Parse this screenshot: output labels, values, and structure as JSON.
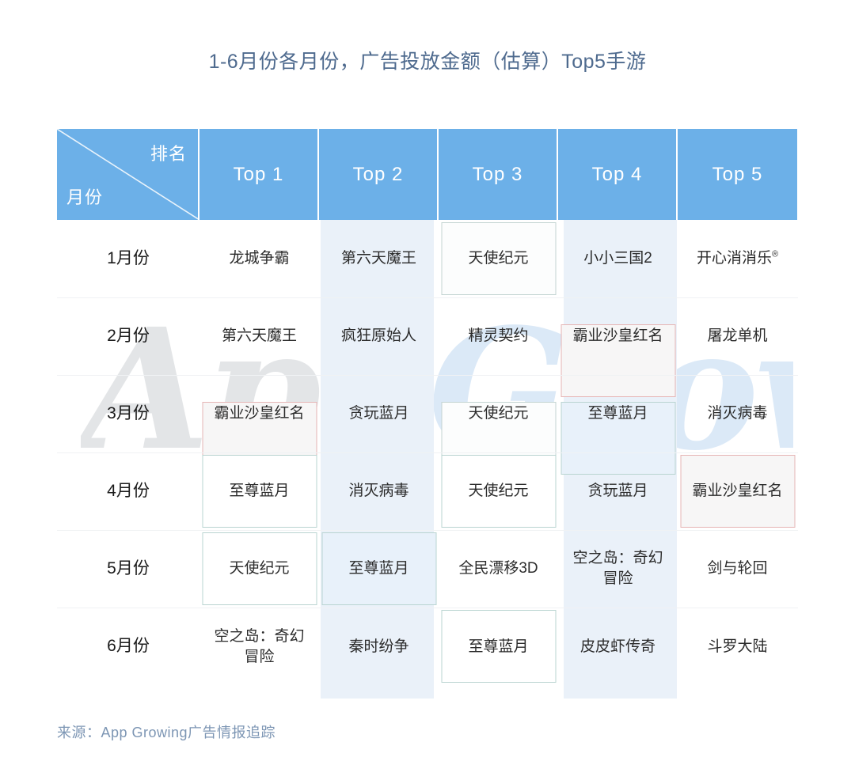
{
  "title": "1-6月份各月份，广告投放金额（估算）Top5手游",
  "source": "来源：App Growing广告情报追踪",
  "watermark": {
    "part1": "App",
    "part2": "Growing"
  },
  "header": {
    "corner_rank": "排名",
    "corner_month": "月份",
    "columns": [
      "Top 1",
      "Top 2",
      "Top 3",
      "Top 4",
      "Top 5"
    ]
  },
  "colors": {
    "header_bg": "#6cb0e8",
    "title_text": "#4e6a8e",
    "source_text": "#7d96b4",
    "column_tint": "#eaf1f9",
    "highlight_teal_border": "#b9d4d1",
    "highlight_pink_border": "#e6b4b4",
    "highlight_teal_fill": "#e8f1fa"
  },
  "rows": [
    {
      "month": "1月份",
      "cells": [
        {
          "text": "龙城争霸"
        },
        {
          "text": "第六天魔王"
        },
        {
          "text": "天使纪元"
        },
        {
          "text": "小小三国2"
        },
        {
          "text": "开心消消乐",
          "sup": "®"
        }
      ]
    },
    {
      "month": "2月份",
      "cells": [
        {
          "text": "第六天魔王"
        },
        {
          "text": "疯狂原始人"
        },
        {
          "text": "精灵契约"
        },
        {
          "text": "霸业沙皇红名"
        },
        {
          "text": "屠龙单机"
        }
      ]
    },
    {
      "month": "3月份",
      "cells": [
        {
          "text": "霸业沙皇红名"
        },
        {
          "text": "贪玩蓝月"
        },
        {
          "text": "天使纪元"
        },
        {
          "text": "至尊蓝月"
        },
        {
          "text": "消灭病毒"
        }
      ]
    },
    {
      "month": "4月份",
      "cells": [
        {
          "text": "至尊蓝月"
        },
        {
          "text": "消灭病毒"
        },
        {
          "text": "天使纪元"
        },
        {
          "text": "贪玩蓝月"
        },
        {
          "text": "霸业沙皇红名"
        }
      ]
    },
    {
      "month": "5月份",
      "cells": [
        {
          "text": "天使纪元"
        },
        {
          "text": "至尊蓝月"
        },
        {
          "text": "全民漂移3D"
        },
        {
          "text": "空之岛：奇幻\n冒险"
        },
        {
          "text": "剑与轮回"
        }
      ]
    },
    {
      "month": "6月份",
      "cells": [
        {
          "text": "空之岛：奇幻\n冒险"
        },
        {
          "text": "秦时纷争"
        },
        {
          "text": "至尊蓝月"
        },
        {
          "text": "皮皮虾传奇"
        },
        {
          "text": "斗罗大陆"
        }
      ]
    }
  ]
}
